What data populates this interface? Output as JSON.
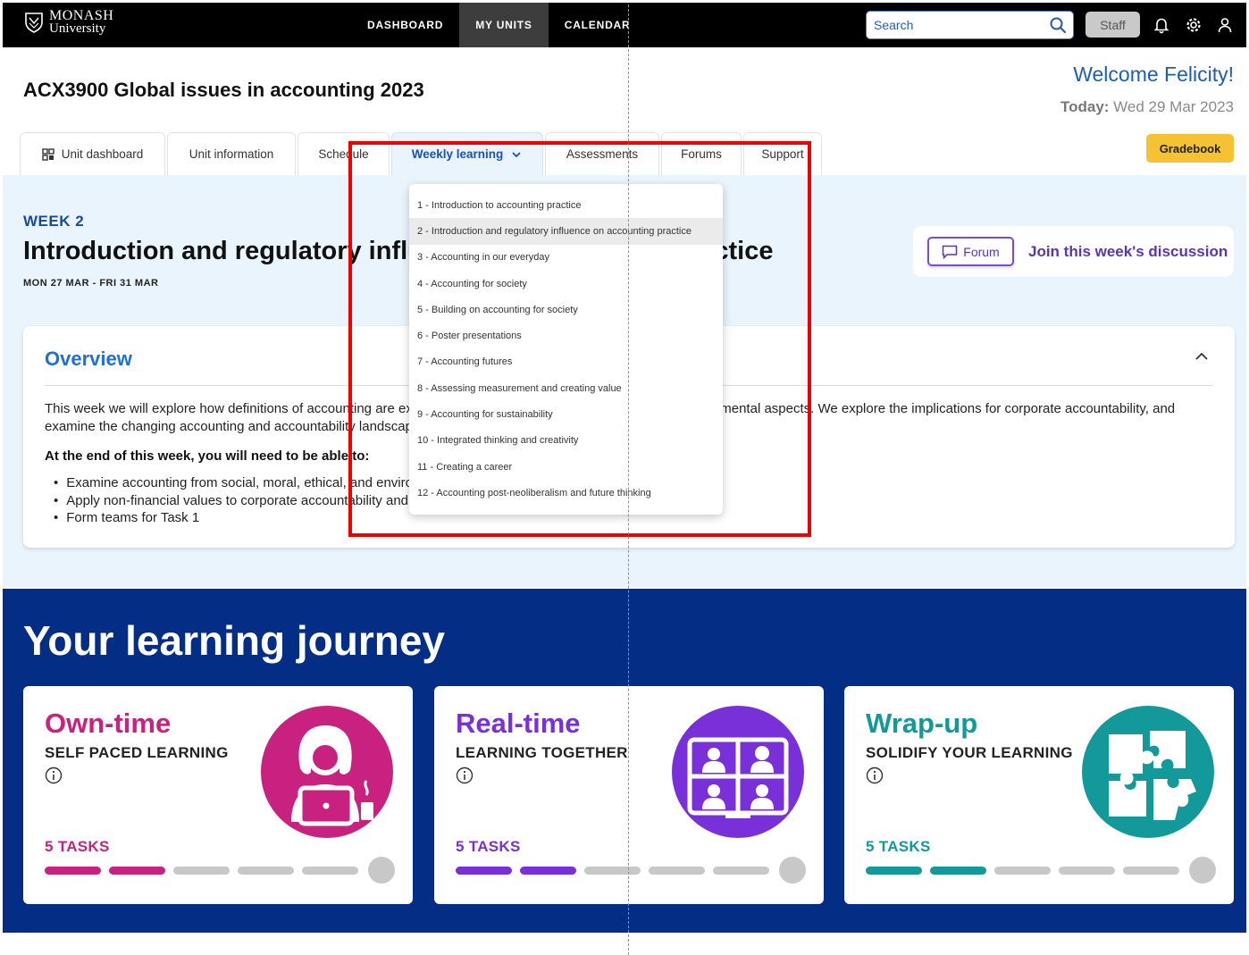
{
  "nav": {
    "logo_line1": "MONASH",
    "logo_line2": "University",
    "links": [
      "DASHBOARD",
      "MY UNITS",
      "CALENDAR"
    ],
    "search_placeholder": "Search",
    "staff_label": "Staff",
    "icons": [
      "bell-icon",
      "gear-icon",
      "user-icon"
    ]
  },
  "header": {
    "unit_title": "ACX3900 Global issues in accounting 2023",
    "welcome": "Welcome Felicity!",
    "today_label": "Today:",
    "today_value": "Wed 29 Mar 2023",
    "gradebook_label": "Gradebook"
  },
  "tabs": [
    {
      "label": "Unit dashboard"
    },
    {
      "label": "Unit information"
    },
    {
      "label": "Schedule"
    },
    {
      "label": "Weekly learning"
    },
    {
      "label": "Assessments"
    },
    {
      "label": "Forums"
    },
    {
      "label": "Support"
    }
  ],
  "week": {
    "label": "WEEK 2",
    "title": "Introduction and regulatory influence on accounting practice",
    "dates": "MON 27 MAR - FRI 31 MAR"
  },
  "forum": {
    "button_label": "Forum",
    "link_label": "Join this week's discussion"
  },
  "overview": {
    "title": "Overview",
    "text": "This week we will explore how definitions of accounting are expanding to include social, moral, ethical and environmental aspects. We explore the implications for corporate accountability, and examine the changing accounting and accountability landscape.",
    "objectives_heading": "At the end of this week, you will need to be able to:",
    "objectives": [
      "Examine accounting from social, moral, ethical, and environmental perspectives",
      "Apply non-financial values to corporate accountability and reporting",
      "Form teams for Task 1"
    ]
  },
  "dropdown": {
    "selected_index": 1,
    "items": [
      "1 - Introduction to accounting practice",
      "2 - Introduction and regulatory influence on accounting practice",
      "3 - Accounting in our everyday",
      "4 - Accounting for society",
      "5 - Building on accounting for society",
      "6 - Poster presentations",
      "7 - Accounting futures",
      "8 - Assessing measurement and creating value",
      "9 - Accounting for sustainability",
      "10 - Integrated thinking and creativity",
      "11 - Creating a career",
      "12 - Accounting post-neoliberalism and future thinking"
    ]
  },
  "journey": {
    "title": "Your learning journey",
    "cards": [
      {
        "title": "Own-time",
        "subtitle": "SELF PACED LEARNING",
        "tasks": "5 TASKS",
        "color": "#c8217f",
        "completed": 2,
        "total": 5,
        "icon": "person-laptop-icon"
      },
      {
        "title": "Real-time",
        "subtitle": "LEARNING TOGETHER",
        "tasks": "5 TASKS",
        "color": "#7a30d8",
        "completed": 2,
        "total": 5,
        "icon": "video-meeting-icon"
      },
      {
        "title": "Wrap-up",
        "subtitle": "SOLIDIFY YOUR LEARNING",
        "tasks": "5 TASKS",
        "color": "#14999a",
        "completed": 2,
        "total": 5,
        "icon": "puzzle-icon"
      }
    ]
  },
  "colors": {
    "nav_bg": "#000000",
    "accent_blue": "#1f6fd8",
    "journey_bg": "#042d85",
    "highlight_box": "#ee0000"
  }
}
